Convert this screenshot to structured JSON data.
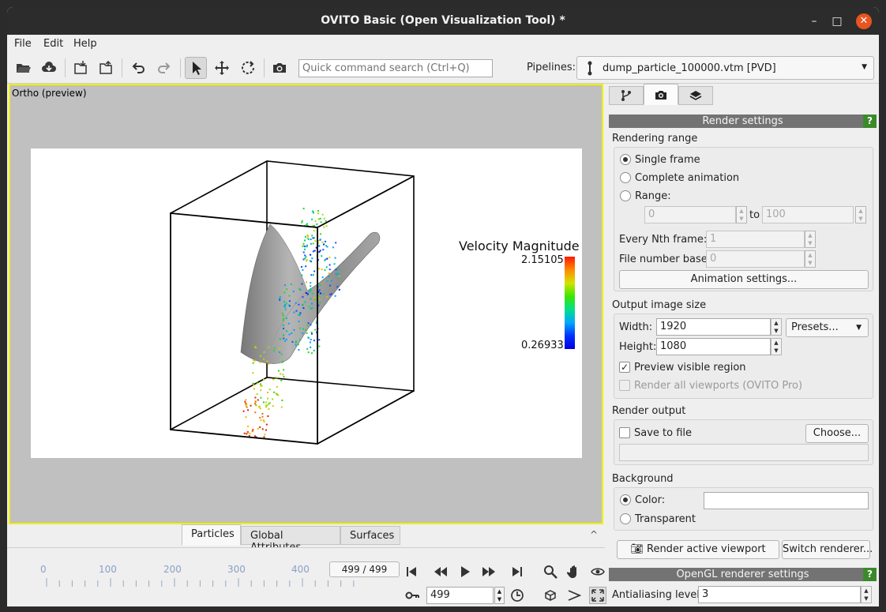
{
  "window": {
    "title": "OVITO Basic (Open Visualization Tool) *",
    "controls": {
      "minimize": "–",
      "maximize": "□",
      "close": "✕"
    }
  },
  "menu": {
    "items": [
      {
        "label": "File"
      },
      {
        "label": "Edit"
      },
      {
        "label": "Help"
      }
    ]
  },
  "toolbar": {
    "search_placeholder": "Quick command search (Ctrl+Q)",
    "pipelines_label": "Pipelines:",
    "pipeline_selected": "dump_particle_100000.vtm [PVD]",
    "icons": [
      "open-folder-icon",
      "download-cloud-icon",
      "import-icon",
      "export-icon",
      "undo-icon",
      "redo-icon",
      "select-cursor-icon",
      "move-icon",
      "rotate-icon",
      "camera-icon"
    ]
  },
  "viewport": {
    "caption": "Ortho (preview)",
    "legend": {
      "title": "Velocity Magnitude",
      "max": "2.15105",
      "min": "0.26933"
    }
  },
  "inspector": {
    "tabs": [
      {
        "label": "Particles",
        "active": true
      },
      {
        "label": "Global Attributes",
        "active": false
      },
      {
        "label": "Surfaces",
        "active": false
      }
    ],
    "collapse_glyph": "^"
  },
  "animation": {
    "tick_labels": [
      "0",
      "100",
      "200",
      "300",
      "400"
    ],
    "time_display": "499 / 499",
    "current_frame": "499",
    "progress": 1.0
  },
  "command_panel": {
    "render_settings_title": "Render settings",
    "help_glyph": "?",
    "rendering_range": {
      "label": "Rendering range",
      "single_frame": "Single frame",
      "complete_animation": "Complete animation",
      "range": "Range:",
      "range_from": "0",
      "range_to_label": "to",
      "range_to": "100",
      "every_nth_label": "Every Nth frame:",
      "every_nth_value": "1",
      "file_number_base_label": "File number base:",
      "file_number_base_value": "0",
      "animation_settings_button": "Animation settings..."
    },
    "output_size": {
      "label": "Output image size",
      "width_label": "Width:",
      "width_value": "1920",
      "height_label": "Height:",
      "height_value": "1080",
      "presets": "Presets...",
      "preview_visible": "Preview visible region",
      "render_all": "Render all viewports (OVITO Pro)"
    },
    "render_output": {
      "label": "Render output",
      "save_to_file": "Save to file",
      "choose_button": "Choose...",
      "file_path": ""
    },
    "background": {
      "label": "Background",
      "color": "Color:",
      "transparent": "Transparent",
      "color_value": "#ffffff"
    },
    "render_active_viewport": "Render active viewport",
    "switch_renderer": "Switch renderer...",
    "opengl_title": "OpenGL renderer settings",
    "antialiasing_label": "Antialiasing level:",
    "antialiasing_value": "3"
  }
}
